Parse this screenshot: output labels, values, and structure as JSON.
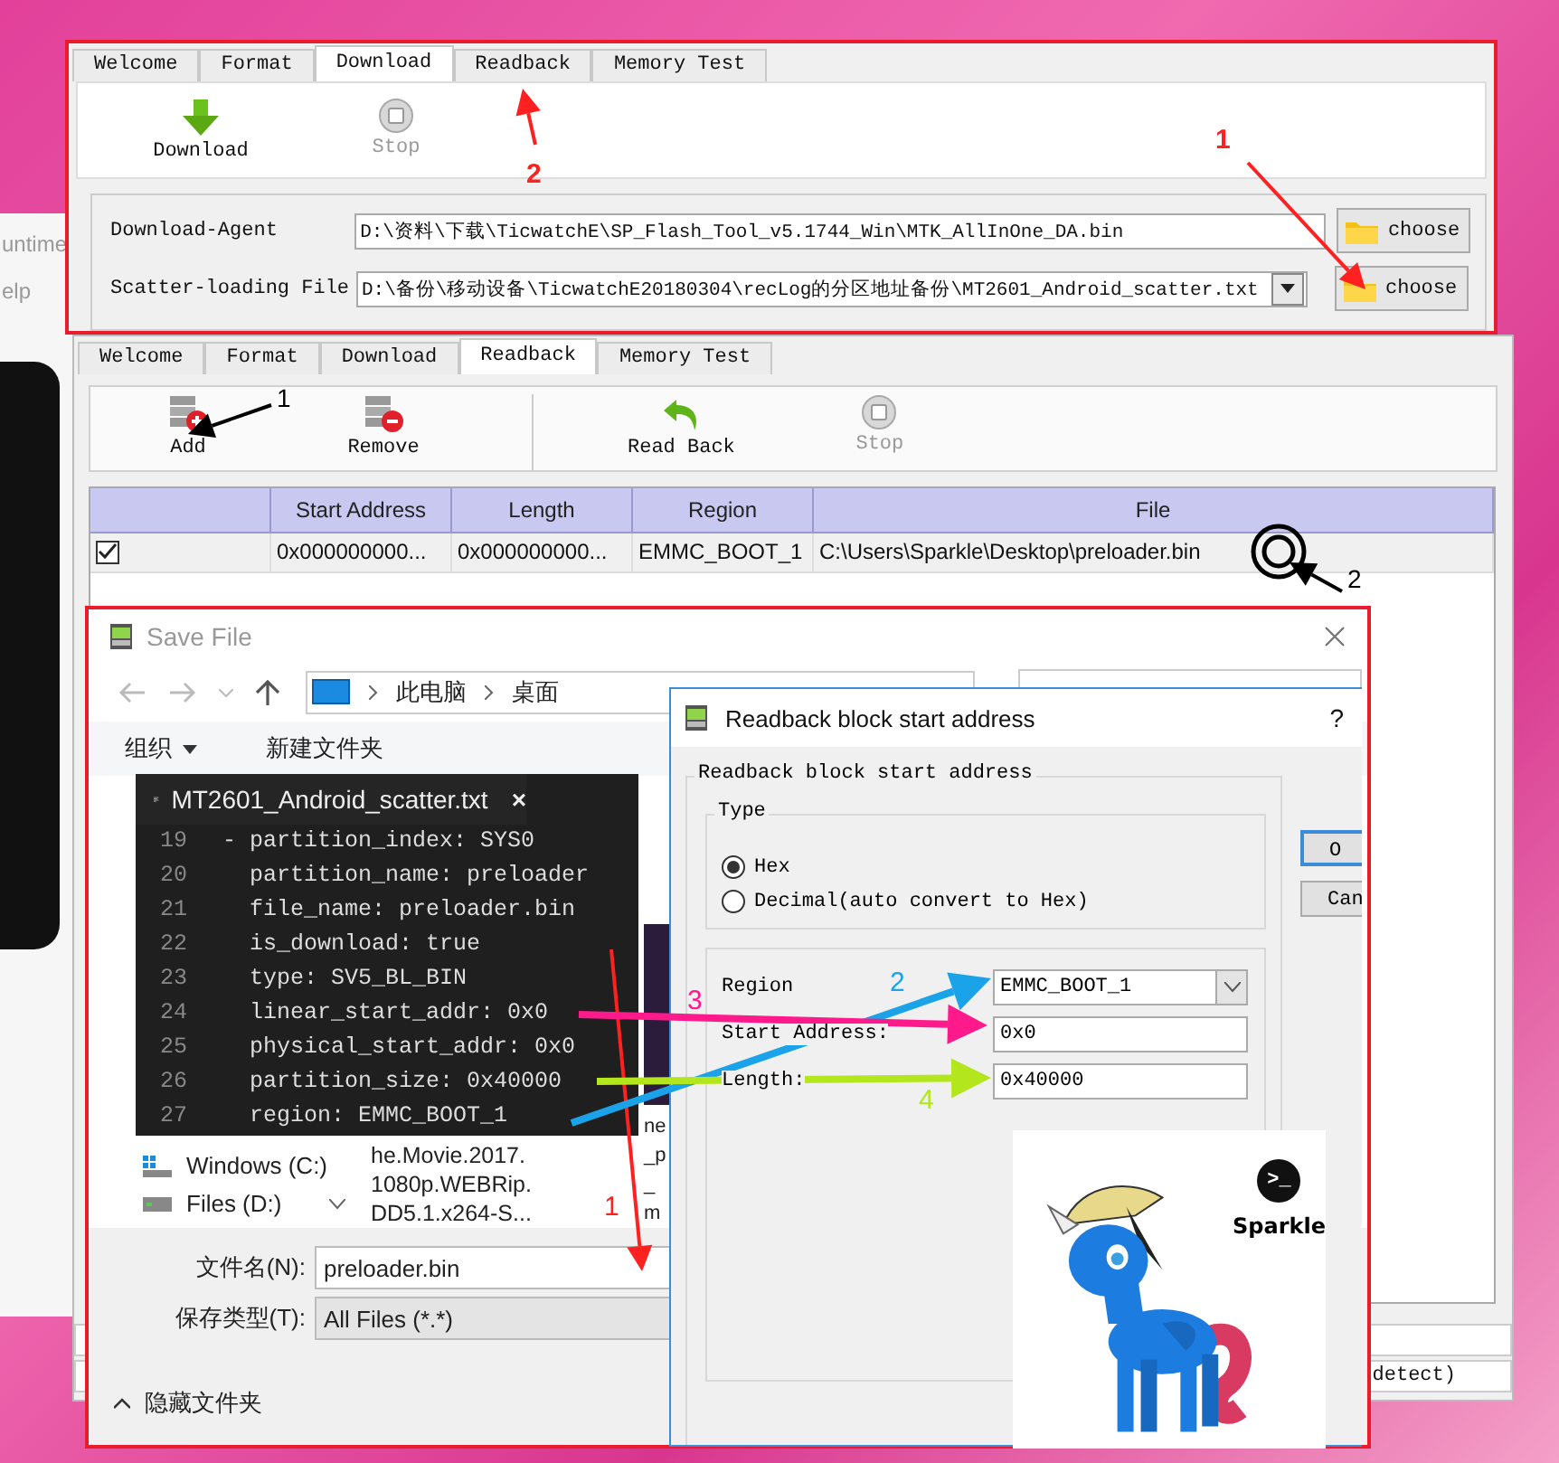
{
  "background_window": {
    "texts": [
      "untime",
      "elp"
    ]
  },
  "download_window": {
    "tabs": [
      {
        "label": "Welcome",
        "selected": false
      },
      {
        "label": "Format",
        "selected": false
      },
      {
        "label": "Download",
        "selected": true
      },
      {
        "label": "Readback",
        "selected": false
      },
      {
        "label": "Memory Test",
        "selected": false
      }
    ],
    "toolbar": [
      [
        {
          "kind": "download",
          "label": "Download",
          "disabled": false
        },
        {
          "kind": "stop",
          "label": "Stop",
          "disabled": true
        }
      ]
    ],
    "fields": [
      {
        "label": "Download-Agent",
        "value": "D:\\资料\\下载\\TicwatchE\\SP_Flash_Tool_v5.1744_Win\\MTK_AllInOne_DA.bin",
        "kind": "text",
        "button": "choose"
      },
      {
        "label": "Scatter-loading File",
        "value": "D:\\备份\\移动设备\\TicwatchE20180304\\recLog的分区地址备份\\MT2601_Android_scatter.txt",
        "kind": "combo",
        "button": "choose"
      }
    ]
  },
  "readback_window": {
    "tabs": [
      {
        "label": "Welcome",
        "selected": false
      },
      {
        "label": "Format",
        "selected": false
      },
      {
        "label": "Download",
        "selected": false
      },
      {
        "label": "Readback",
        "selected": true
      },
      {
        "label": "Memory Test",
        "selected": false
      }
    ],
    "toolbar": [
      [
        {
          "kind": "add",
          "label": "Add",
          "disabled": false
        },
        {
          "kind": "remove",
          "label": "Remove",
          "disabled": false
        }
      ],
      [
        {
          "kind": "readback",
          "label": "Read Back",
          "disabled": false
        },
        {
          "kind": "stop",
          "label": "Stop",
          "disabled": true
        }
      ]
    ],
    "table": {
      "columns": [
        "Start Address",
        "Length",
        "Region",
        "File"
      ],
      "rows": [
        {
          "checked": true,
          "cells": [
            "0x000000000...",
            "0x000000000...",
            "EMMC_BOOT_1",
            "C:\\Users\\Sparkle\\Desktop\\preloader.bin"
          ]
        }
      ]
    },
    "status_text": "detect)"
  },
  "save_dialog": {
    "title": "Save File",
    "breadcrumb": [
      "此电脑",
      "桌面"
    ],
    "toolbar": [
      {
        "label": "组织",
        "kind": "menu"
      },
      {
        "label": "新建文件夹",
        "kind": "plain"
      }
    ],
    "drives": [
      {
        "label": "Windows (C:)",
        "kind": "system"
      },
      {
        "label": "Files (D:)",
        "kind": "data"
      }
    ],
    "files": [
      {
        "lines": [
          "he.Movie.2017.",
          "1080p.WEBRip.",
          "DD5.1.x264-S..."
        ]
      },
      {
        "lines": [
          "ne",
          "_p",
          "_",
          "m"
        ]
      }
    ],
    "filename": {
      "label": "文件名(N):",
      "value": "preloader.bin"
    },
    "filetype": {
      "label": "保存类型(T):",
      "value": "All Files (*.*)"
    },
    "hide_folders": "隐藏文件夹"
  },
  "editor": {
    "tab": "MT2601_Android_scatter.txt",
    "close": "×",
    "lines": [
      {
        "number": "19",
        "text": "- partition_index: SYS0"
      },
      {
        "number": "20",
        "text": "  partition_name: preloader"
      },
      {
        "number": "21",
        "text": "  file_name: preloader.bin"
      },
      {
        "number": "22",
        "text": "  is_download: true"
      },
      {
        "number": "23",
        "text": "  type: SV5_BL_BIN"
      },
      {
        "number": "24",
        "text": "  linear_start_addr: 0x0"
      },
      {
        "number": "25",
        "text": "  physical_start_addr: 0x0"
      },
      {
        "number": "26",
        "text": "  partition_size: 0x40000"
      },
      {
        "number": "27",
        "text": "  region: EMMC_BOOT_1"
      }
    ]
  },
  "address_dialog": {
    "title": "Readback block start address",
    "help": "?",
    "group_title": "Readback block start address",
    "type_group": {
      "title": "Type",
      "options": [
        {
          "label": "Hex",
          "selected": true
        },
        {
          "label": "Decimal(auto convert to Hex)",
          "selected": false
        }
      ]
    },
    "fields": [
      {
        "label": "Region",
        "value": "EMMC_BOOT_1",
        "kind": "combo"
      },
      {
        "label": "Start Address:",
        "value": "0x0",
        "kind": "text"
      },
      {
        "label": "Length:",
        "value": "0x40000",
        "kind": "text"
      }
    ],
    "buttons": [
      "O",
      "Can"
    ]
  },
  "logo": {
    "prompt": ">_",
    "name": "Sparkle"
  },
  "annotations": [
    {
      "label": "1",
      "color": "#ff2020",
      "kind": "arrow"
    },
    {
      "label": "2",
      "color": "#ff2020",
      "kind": "arrow"
    },
    {
      "label": "1",
      "color": "#000000",
      "kind": "arrow"
    },
    {
      "label": "2",
      "color": "#000000",
      "kind": "target"
    },
    {
      "label": "1",
      "color": "#ff2020",
      "kind": "arrow"
    },
    {
      "label": "2",
      "color": "#1aa3e8",
      "kind": "arrow"
    },
    {
      "label": "3",
      "color": "#ff1a8c",
      "kind": "arrow"
    },
    {
      "label": "4",
      "color": "#b4e61e",
      "kind": "arrow"
    }
  ]
}
